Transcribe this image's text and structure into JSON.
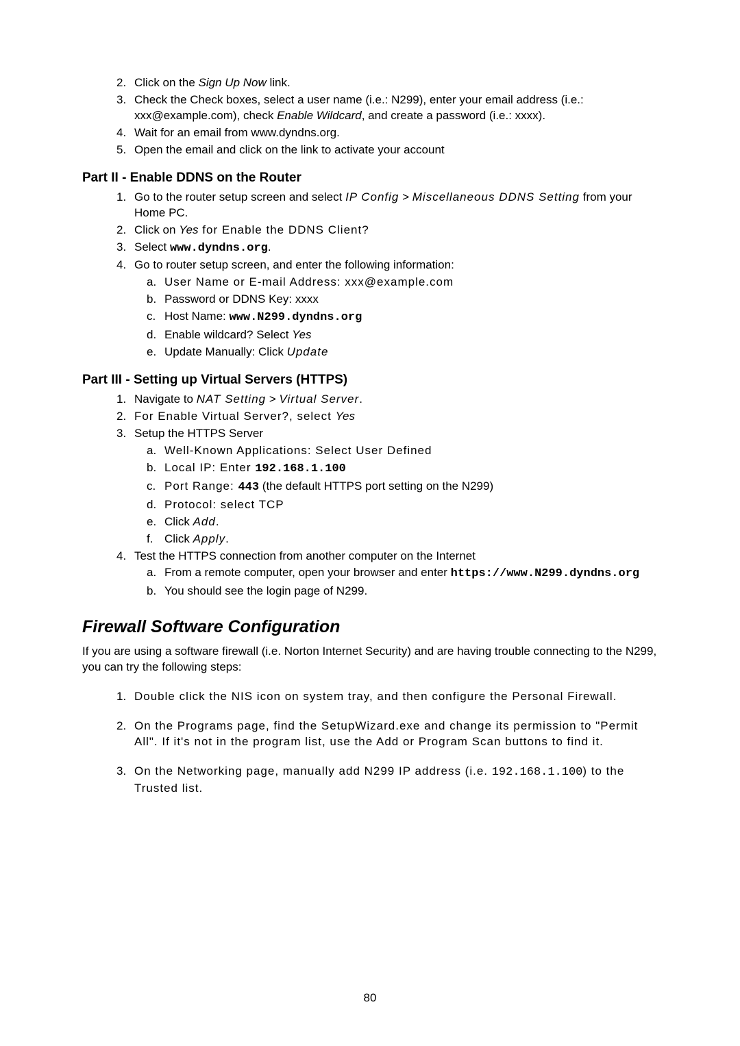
{
  "blockA": {
    "items": [
      {
        "num": "2.",
        "t1": "Click on the ",
        "i1": "Sign Up Now",
        "t2": " link."
      },
      {
        "num": "3.",
        "t1": "Check the Check boxes, select a user name (i.e.: N299), enter your email address (i.e.: xxx@example.com), check ",
        "i1": "Enable Wildcard",
        "t2": ", and create a password (i.e.: xxxx)."
      },
      {
        "num": "4.",
        "t1": "Wait for an email from www.dyndns.org."
      },
      {
        "num": "5.",
        "t1": "Open the email and click on the link to activate your account"
      }
    ]
  },
  "part2": {
    "heading": "Part II - Enable DDNS on the Router",
    "items": [
      {
        "num": "1.",
        "t1": "Go to the router setup screen and select ",
        "i1": "IP Config",
        "mid": " > ",
        "i2": "Miscellaneous DDNS Setting",
        "t2": " from your Home PC."
      },
      {
        "num": "2.",
        "t1": "Click on ",
        "i1": "Yes",
        "t2": " for Enable the DDNS Client?"
      },
      {
        "num": "3.",
        "t1": "Select ",
        "m1": "www.dyndns.org",
        "t2": "."
      },
      {
        "num": "4.",
        "t1": "Go to router setup screen, and enter the following information:"
      }
    ],
    "sub": [
      {
        "num": "a.",
        "t1": "User Name or E-mail Address: xxx@example.com"
      },
      {
        "num": "b.",
        "t1": "Password or DDNS Key: xxxx"
      },
      {
        "num": "c.",
        "t1": "Host Name: ",
        "m1": "www.N299.dyndns.org"
      },
      {
        "num": "d.",
        "t1": "Enable wildcard? Select ",
        "i1": "Yes"
      },
      {
        "num": "e.",
        "t1": "Update Manually: Click ",
        "i1": "Update"
      }
    ]
  },
  "part3": {
    "heading": "Part III - Setting up Virtual Servers (HTTPS)",
    "items": [
      {
        "num": "1.",
        "t1": "Navigate to ",
        "i1": "NAT Setting",
        "mid": " > ",
        "i2": "Virtual Server",
        "t2": "."
      },
      {
        "num": "2.",
        "t1": "For Enable Virtual Server?, select ",
        "i1": "Yes"
      },
      {
        "num": "3.",
        "t1": "Setup the HTTPS Server"
      }
    ],
    "sub": [
      {
        "num": "a.",
        "t1": "Well-Known Applications: Select User Defined"
      },
      {
        "num": "b.",
        "t1": "Local IP: Enter ",
        "m1": "192.168.1.100"
      },
      {
        "num": "c.",
        "t1": "Port Range: ",
        "m1": "443",
        "t2": " (the default HTTPS port setting on the N299)"
      },
      {
        "num": "d.",
        "t1": "Protocol: select TCP"
      },
      {
        "num": "e.",
        "t1": "Click ",
        "i1": "Add",
        "t2": "."
      },
      {
        "num": "f.",
        "t1": "Click ",
        "i1": "Apply",
        "t2": "."
      }
    ],
    "item4": {
      "num": "4.",
      "t1": "Test the HTTPS connection from another computer on the Internet"
    },
    "sub2": [
      {
        "num": "a.",
        "t1": "From a remote computer, open your browser and enter ",
        "m1": "https://www.N299.dyndns.org"
      },
      {
        "num": "b.",
        "t1": "You should see the login page of N299."
      }
    ]
  },
  "firewall": {
    "heading": "Firewall Software Configuration",
    "intro": "If you are using a software firewall (i.e. Norton Internet Security) and are having trouble connecting to the N299, you can try the following steps:",
    "items": [
      {
        "num": "1.",
        "t": "Double click the NIS icon on system tray, and then configure the Personal Firewall."
      },
      {
        "num": "2.",
        "t": "On the Programs page, find the SetupWizard.exe and change its permission to \"Permit All\". If it's not in the program list, use the Add or Program Scan buttons to find it."
      },
      {
        "num": "3.",
        "pre": "On the Networking page, manually add N299 IP address (i.e. ",
        "ip": "192.168.1.100",
        "post": ") to the Trusted list."
      }
    ]
  },
  "pageNum": "80"
}
